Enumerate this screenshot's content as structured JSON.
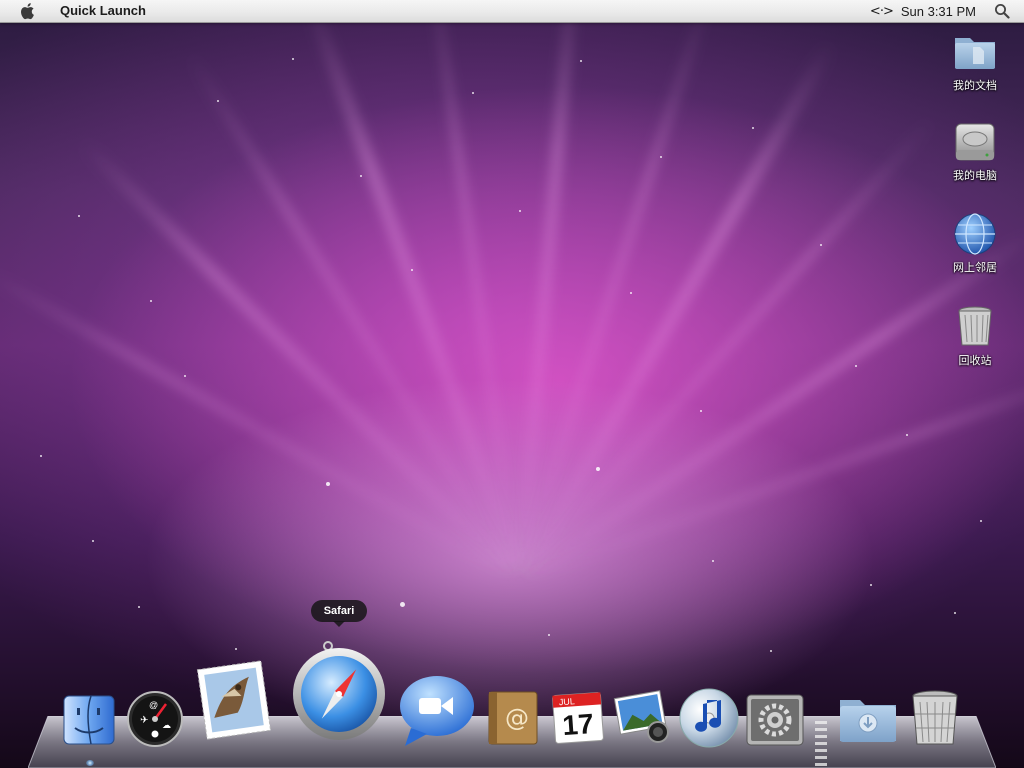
{
  "menubar": {
    "app_name": "Quick Launch",
    "network_symbol": "<·>",
    "clock": "Sun 3:31 PM",
    "apple_icon": "apple-logo-icon",
    "spotlight_icon": "magnifier-icon"
  },
  "desktop_icons": [
    {
      "label": "我的文档",
      "icon": "folder-icon"
    },
    {
      "label": "我的电脑",
      "icon": "hard-drive-icon"
    },
    {
      "label": "网上邻居",
      "icon": "network-globe-icon"
    },
    {
      "label": "回收站",
      "icon": "trash-icon"
    }
  ],
  "dock": {
    "tooltip": "Safari",
    "items": [
      {
        "name": "Finder",
        "icon": "finder-icon"
      },
      {
        "name": "Dashboard",
        "icon": "dashboard-icon"
      },
      {
        "name": "Mail",
        "icon": "mail-stamp-icon"
      },
      {
        "name": "Safari",
        "icon": "safari-compass-icon"
      },
      {
        "name": "iChat",
        "icon": "ichat-video-icon"
      },
      {
        "name": "Address Book",
        "icon": "address-book-icon"
      },
      {
        "name": "iCal",
        "icon": "ical-calendar-icon",
        "month": "JUL",
        "day": "17"
      },
      {
        "name": "iPhoto",
        "icon": "iphoto-icon"
      },
      {
        "name": "iTunes",
        "icon": "itunes-icon"
      },
      {
        "name": "System Preferences",
        "icon": "system-preferences-icon"
      },
      {
        "name": "Downloads",
        "icon": "downloads-folder-icon"
      },
      {
        "name": "Trash",
        "icon": "trash-can-icon"
      }
    ]
  },
  "colors": {
    "wallpaper_glow": "#e65ad2",
    "menubar": "#e9e9e9",
    "tooltip_bg": "#141414"
  }
}
